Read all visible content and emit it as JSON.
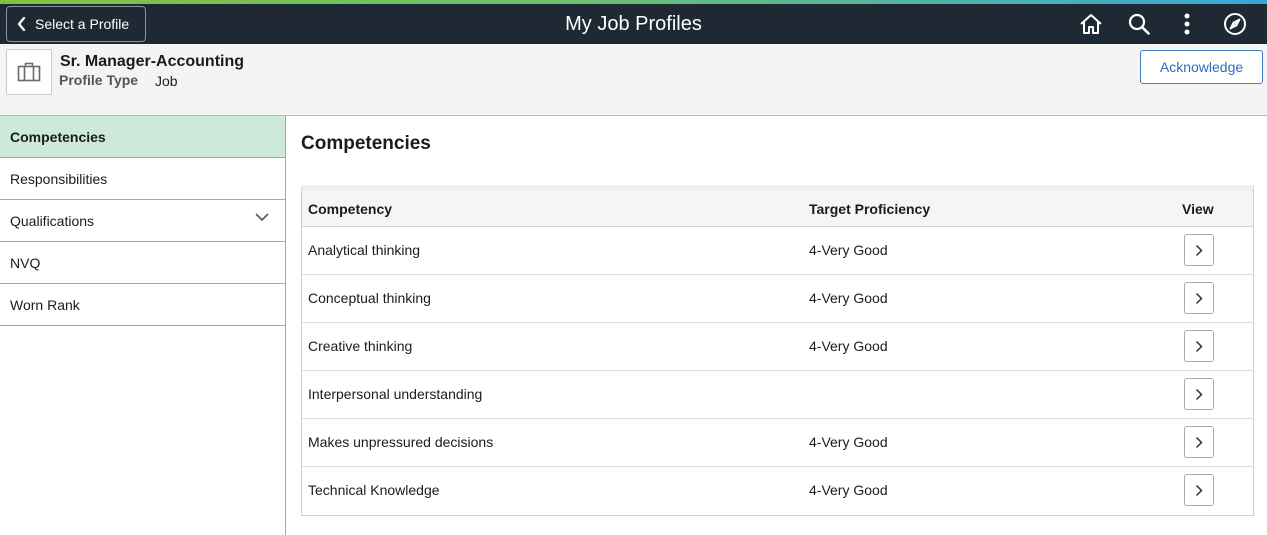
{
  "header_bar": {
    "back_label": "Select a Profile",
    "title": "My Job Profiles",
    "icons": [
      "home-icon",
      "search-icon",
      "more-options-icon",
      "navbar-compass-icon"
    ]
  },
  "profile": {
    "name": "Sr. Manager-Accounting",
    "type_label": "Profile Type",
    "type_value": "Job",
    "acknowledge_label": "Acknowledge"
  },
  "sidebar": {
    "items": [
      {
        "label": "Competencies",
        "active": true
      },
      {
        "label": "Responsibilities",
        "active": false
      },
      {
        "label": "Qualifications",
        "active": false,
        "expandable": true
      },
      {
        "label": "NVQ",
        "active": false
      },
      {
        "label": "Worn Rank",
        "active": false
      }
    ]
  },
  "main": {
    "section_title": "Competencies",
    "columns": [
      "Competency",
      "Target Proficiency",
      "View"
    ],
    "rows": [
      {
        "competency": "Analytical thinking",
        "proficiency": "4-Very Good"
      },
      {
        "competency": "Conceptual thinking",
        "proficiency": "4-Very Good"
      },
      {
        "competency": "Creative thinking",
        "proficiency": "4-Very Good"
      },
      {
        "competency": "Interpersonal understanding",
        "proficiency": ""
      },
      {
        "competency": "Makes unpressured decisions",
        "proficiency": "4-Very Good"
      },
      {
        "competency": "Technical Knowledge",
        "proficiency": "4-Very Good"
      }
    ]
  },
  "colors": {
    "topbar": "#1f2933",
    "active_nav": "#cde9da",
    "accent_link": "#2e6dbd"
  }
}
